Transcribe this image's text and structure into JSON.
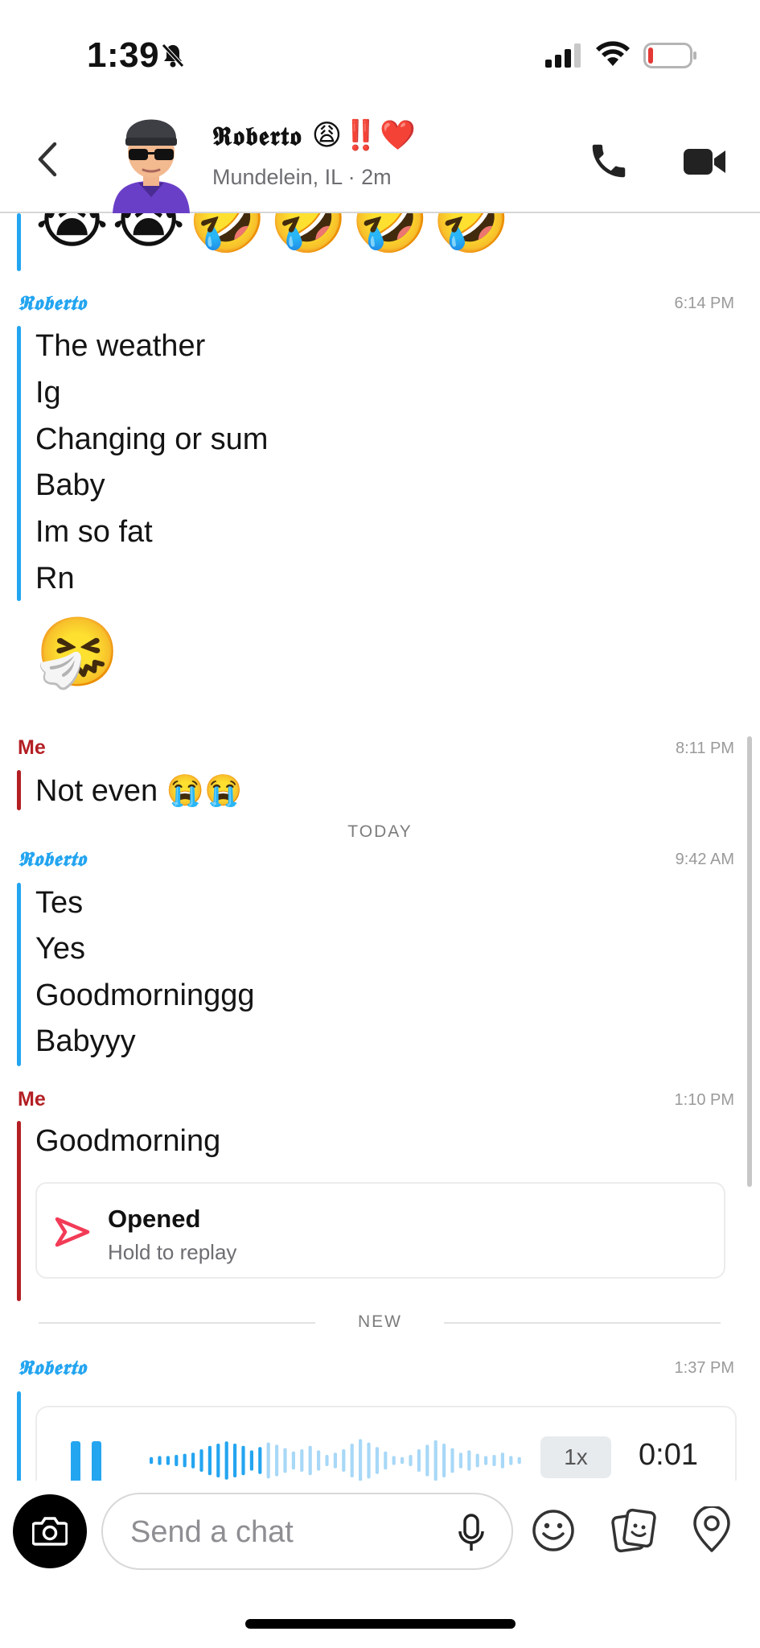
{
  "status_bar": {
    "time": "1:39",
    "icons": [
      "bell-slash-icon",
      "cellular-signal-icon",
      "wifi-icon",
      "battery-low-icon"
    ],
    "battery_color": "#e53935"
  },
  "header": {
    "contact_name": "𝕽𝖔𝖇𝖊𝖗𝖙𝖔",
    "contact_emojis": "😩‼️❤️",
    "subtitle": "Mundelein, IL · 2m",
    "icons": [
      "back-chevron-icon",
      "phone-icon",
      "video-camera-icon"
    ]
  },
  "colors": {
    "roberto_accent": "#24a5f0",
    "me_accent": "#b31f24",
    "snap_red": "#f23c57"
  },
  "messages": {
    "top_emojis": "😭😭🤣🤣🤣🤣",
    "group1": {
      "sender": "𝕽𝖔𝖇𝖊𝖗𝖙𝖔",
      "time": "6:14 PM",
      "lines": [
        "The weather",
        "Ig",
        "Changing or sum",
        "Baby",
        "Im so fat",
        "Rn"
      ],
      "emoji": "🤧"
    },
    "group2": {
      "sender": "Me",
      "time": "8:11 PM",
      "text": "Not even 😭😭"
    },
    "today_label": "TODAY",
    "group3": {
      "sender": "𝕽𝖔𝖇𝖊𝖗𝖙𝖔",
      "time": "9:42 AM",
      "lines": [
        "Tes",
        "Yes",
        "Goodmorninggg",
        "Babyyy"
      ]
    },
    "group4": {
      "sender": "Me",
      "time": "1:10 PM",
      "text": "Goodmorning",
      "snap_status": "Opened",
      "snap_hint": "Hold to replay"
    },
    "new_label": "NEW",
    "group5": {
      "sender": "𝕽𝖔𝖇𝖊𝖗𝖙𝖔",
      "time": "1:37 PM",
      "voice_speed": "1x",
      "voice_duration": "0:01"
    }
  },
  "input_bar": {
    "placeholder": "Send a chat",
    "icons": [
      "camera-icon",
      "microphone-icon",
      "smiley-icon",
      "sticker-icon",
      "map-pin-icon"
    ]
  }
}
